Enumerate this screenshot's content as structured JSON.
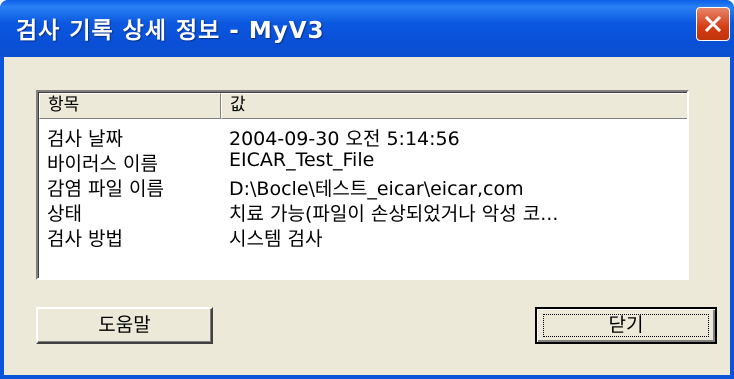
{
  "window": {
    "title": "검사 기록 상세 정보 - MyV3",
    "close_icon": "close-x-icon"
  },
  "list": {
    "columns": [
      "항목",
      "값"
    ],
    "rows": [
      {
        "key": "검사 날짜",
        "value": "2004-09-30 오전 5:14:56"
      },
      {
        "key": "바이러스 이름",
        "value": "EICAR_Test_File"
      },
      {
        "key": "감염 파일 이름",
        "value": "D:\\Bocle\\테스트_eicar\\eicar,com"
      },
      {
        "key": "상태",
        "value": "치료 가능(파일이 손상되었거나 악성 코..."
      },
      {
        "key": "검사 방법",
        "value": "시스템 검사"
      }
    ]
  },
  "buttons": {
    "help_label": "도움말",
    "close_label": "닫기"
  },
  "colors": {
    "titlebar": "#0a54d9",
    "dialog_face": "#ece9d8",
    "close_button": "#d43c14"
  }
}
